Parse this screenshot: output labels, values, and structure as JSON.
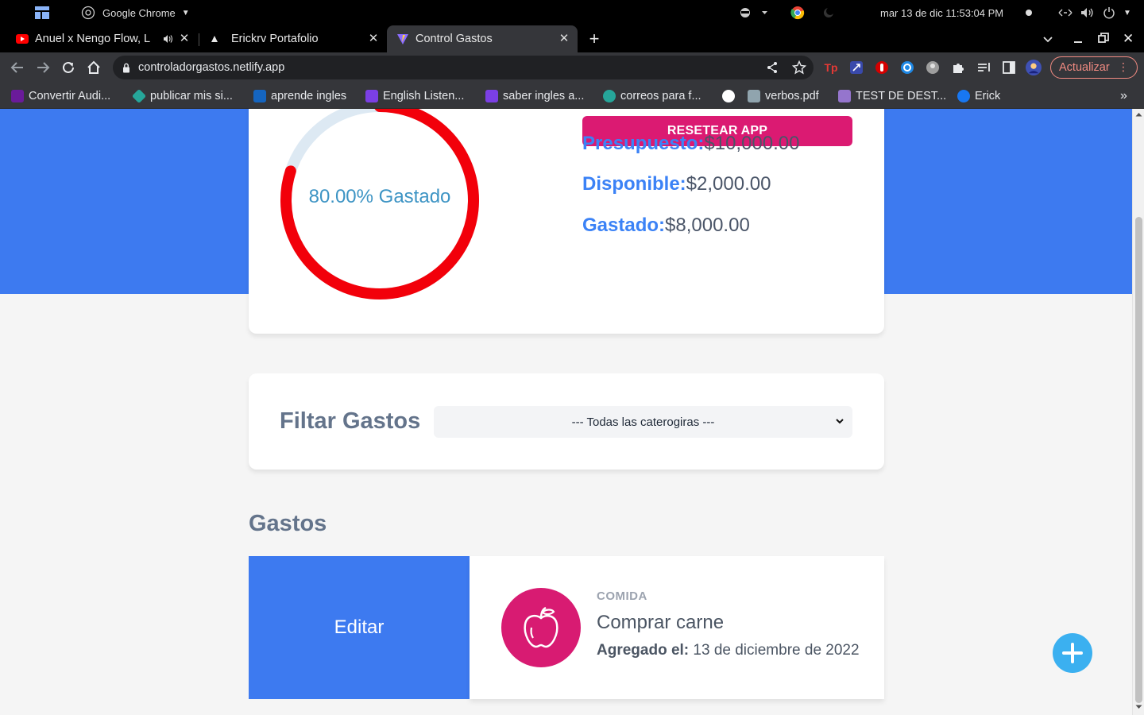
{
  "system_bar": {
    "app_name": "Google Chrome",
    "datetime": "mar 13 de dic  11:53:04 PM"
  },
  "tabs": [
    {
      "title": "Anuel x Nengo Flow, L",
      "icon": "youtube-icon",
      "active": false
    },
    {
      "title": "Erickrv Portafolio",
      "icon": "triangle-icon",
      "active": false
    },
    {
      "title": "Control Gastos",
      "icon": "vite-icon",
      "active": true
    }
  ],
  "toolbar": {
    "url": "controladorgastos.netlify.app",
    "update_label": "Actualizar"
  },
  "bookmarks": [
    {
      "label": "Convertir Audi...",
      "color": "#6a1b9a"
    },
    {
      "label": "publicar mis si...",
      "color": "#26a69a"
    },
    {
      "label": "aprende ingles",
      "color": "#1565c0"
    },
    {
      "label": "English Listen...",
      "color": "#7b3fe4"
    },
    {
      "label": "saber ingles a...",
      "color": "#7b3fe4"
    },
    {
      "label": "correos para f...",
      "color": "#26a69a"
    },
    {
      "label": "",
      "color": "#ffffff"
    },
    {
      "label": "verbos.pdf",
      "color": "#90a4ae"
    },
    {
      "label": "TEST DE DEST...",
      "color": "#9575cd"
    },
    {
      "label": "Erick",
      "color": "#1877f2"
    }
  ],
  "budget": {
    "reset_label": "RESETEAR APP",
    "percent_spent": 80,
    "ring_label": "80.00% Gastado",
    "presupuesto_label": "Presupuesto:",
    "presupuesto_value": "$10,000.00",
    "disponible_label": "Disponible:",
    "disponible_value": "$2,000.00",
    "gastado_label": "Gastado:",
    "gastado_value": "$8,000.00"
  },
  "filter": {
    "title": "Filtar Gastos",
    "selected": "--- Todas las caterogiras ---"
  },
  "expenses": {
    "title": "Gastos",
    "edit_label": "Editar",
    "items": [
      {
        "category": "COMIDA",
        "name": "Comprar carne",
        "date_label": "Agregado el:",
        "date_value": "13 de diciembre de 2022",
        "icon": "apple-icon"
      }
    ]
  },
  "colors": {
    "brand_blue": "#3d7af0",
    "reset_pink": "#db1a72",
    "ring_red": "#f2000a",
    "fab_blue": "#3bb0f0"
  }
}
